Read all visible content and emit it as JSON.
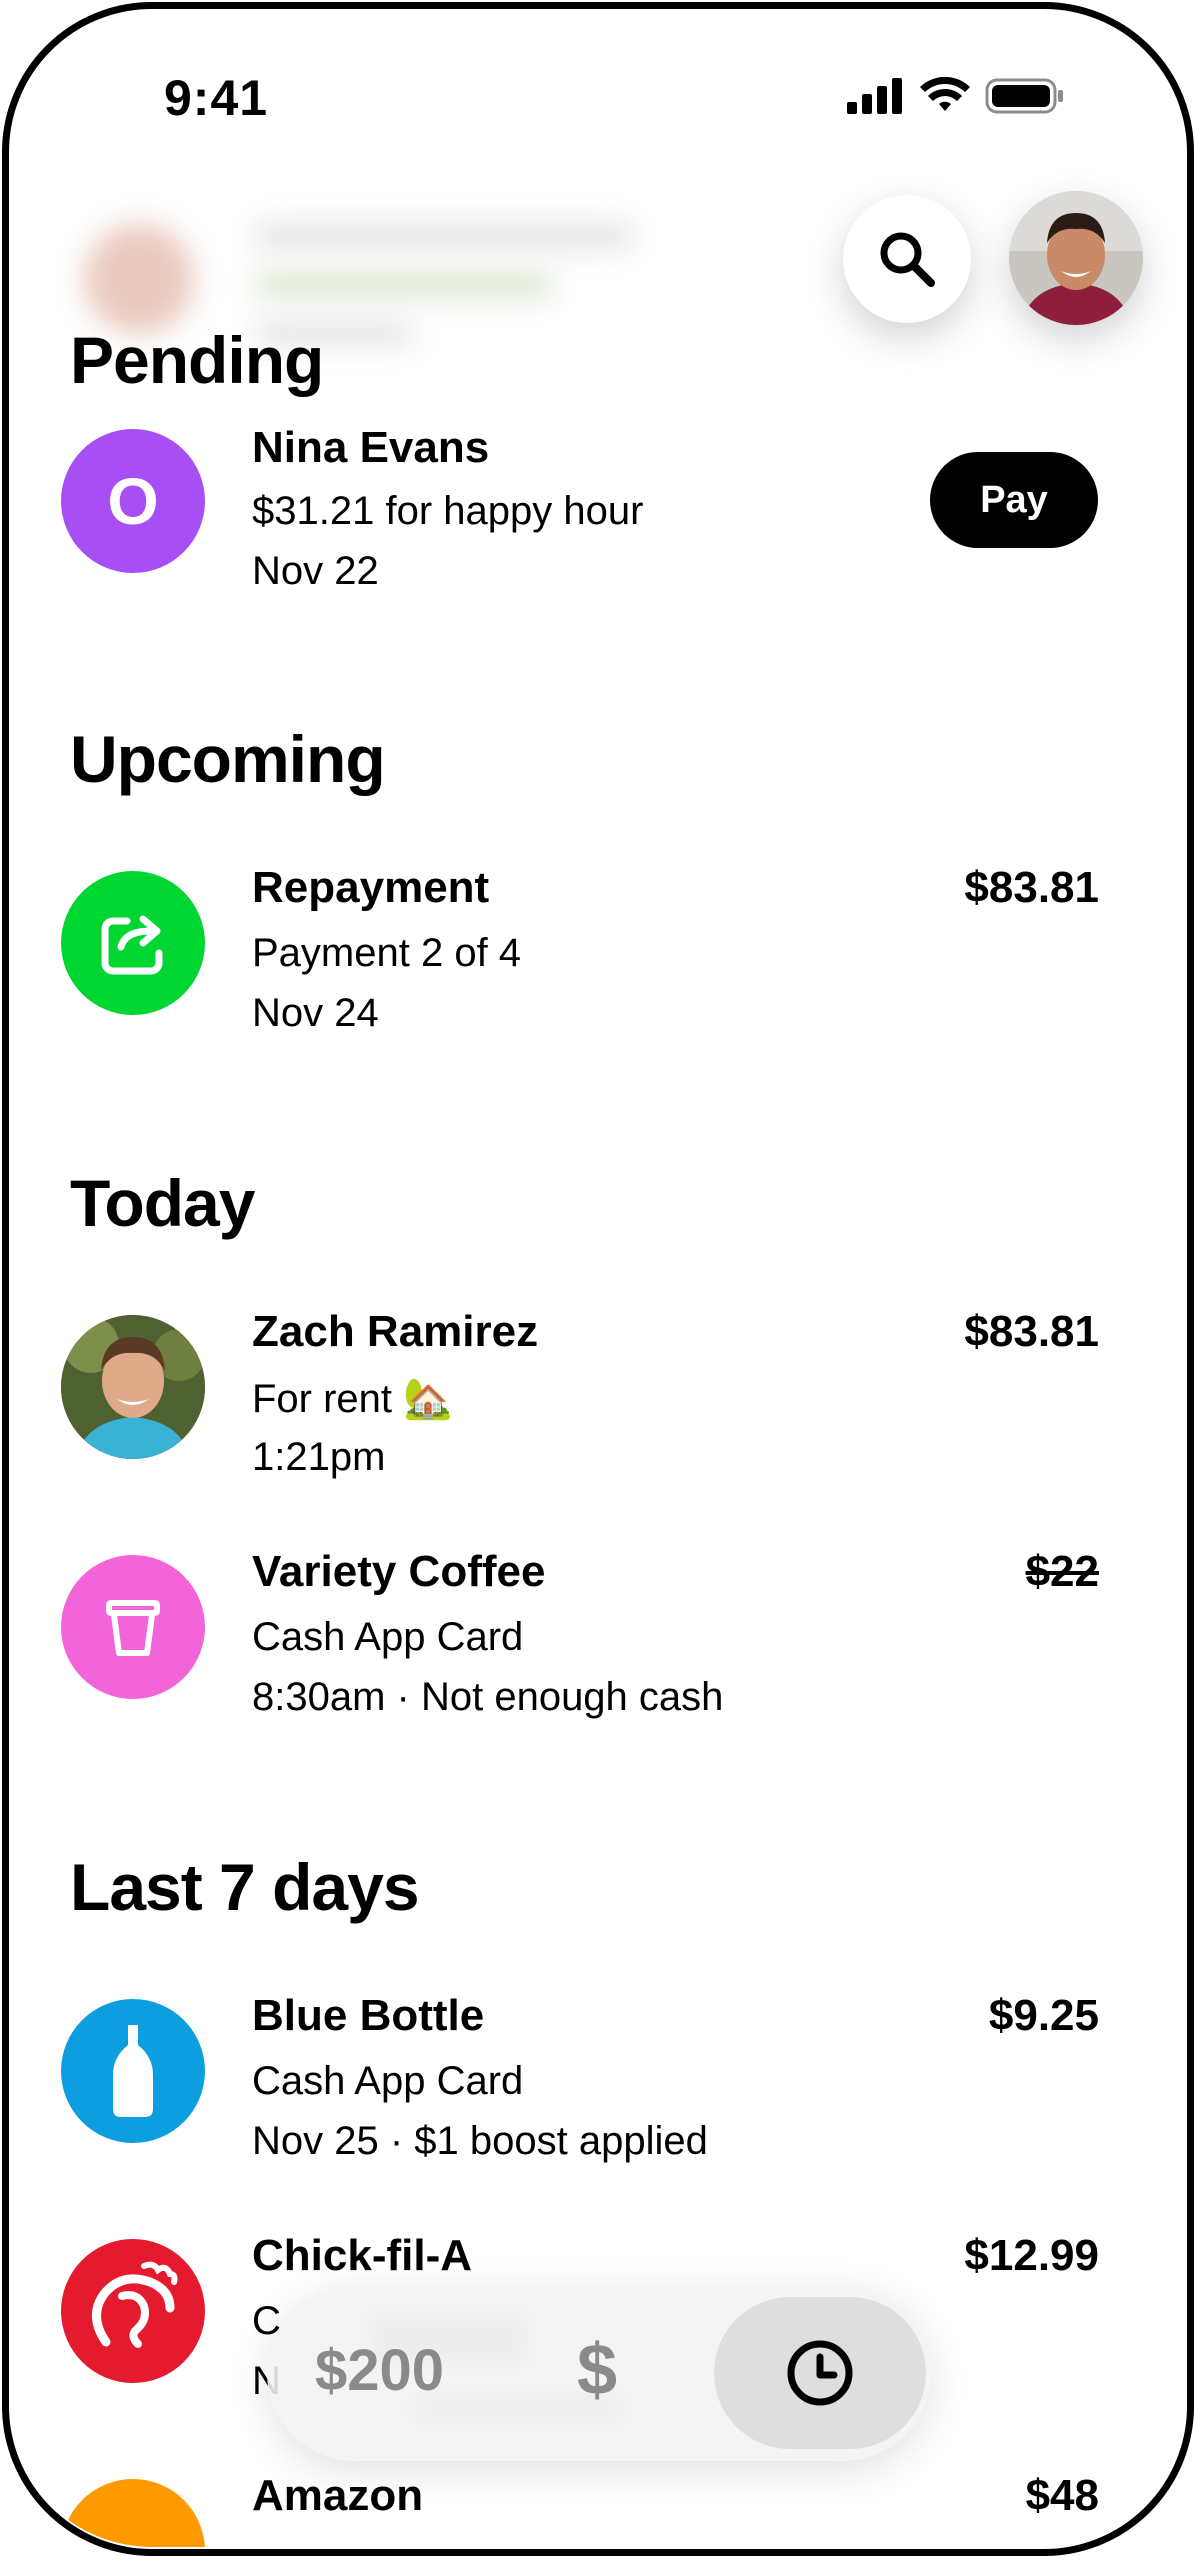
{
  "status_bar": {
    "time": "9:41"
  },
  "header": {
    "search_icon": "search-icon",
    "avatar": "profile-avatar"
  },
  "sections": {
    "pending": {
      "title": "Pending",
      "item": {
        "name": "Nina Evans",
        "avatar_letter": "O",
        "avatar_color": "#a84ef5",
        "description": "$31.21 for happy hour",
        "date": "Nov 22",
        "action": "Pay"
      }
    },
    "upcoming": {
      "title": "Upcoming",
      "item": {
        "name": "Repayment",
        "amount": "$83.81",
        "description": "Payment 2 of 4",
        "date": "Nov 24",
        "icon": "repayment-arrow-icon",
        "icon_color": "#00d632"
      }
    },
    "today": {
      "title": "Today",
      "items": [
        {
          "name": "Zach Ramirez",
          "amount": "$83.81",
          "description": "For rent 🏡",
          "time": "1:21pm",
          "icon": "zach-avatar"
        },
        {
          "name": "Variety Coffee",
          "amount": "$22",
          "description": "Cash App Card",
          "time": "8:30am · Not enough cash",
          "icon": "coffee-cup-icon",
          "icon_color": "#f364d9"
        }
      ]
    },
    "last7": {
      "title": "Last 7 days",
      "items": [
        {
          "name": "Blue Bottle",
          "amount": "$9.25",
          "description": "Cash App Card",
          "date": "Nov 25 · $1 boost applied",
          "icon": "blue-bottle-icon",
          "icon_color": "#0d9ee0"
        },
        {
          "name": "Chick-fil-A",
          "amount": "$12.99",
          "description": "C",
          "date": "N",
          "icon": "chick-fil-a-logo",
          "icon_color": "#e41b2f"
        },
        {
          "name": "Amazon",
          "amount": "$48",
          "icon": "amazon-logo",
          "icon_color": "#ff9900"
        }
      ]
    }
  },
  "bottom_bar": {
    "balance": "$200",
    "money_tab": "$",
    "activity_icon": "clock-icon"
  },
  "colors": {
    "green": "#00d632",
    "purple": "#a84ef5",
    "pink": "#f364d9",
    "blue": "#0d9ee0",
    "red": "#e41b2f",
    "orange": "#ff9900"
  }
}
